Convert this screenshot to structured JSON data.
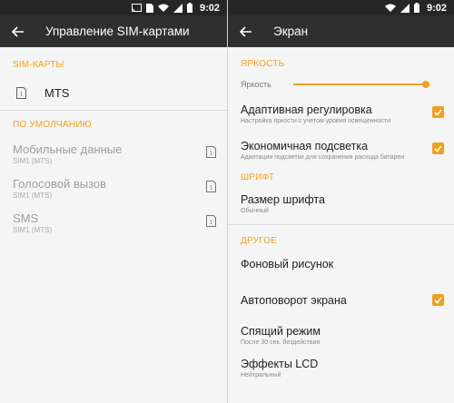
{
  "status": {
    "time": "9:02",
    "icons": [
      "cast-icon",
      "sim-icon",
      "wifi-icon",
      "signal-icon",
      "battery-icon"
    ]
  },
  "left": {
    "title": "Управление SIM-картами",
    "section_sim": "SIM-КАРТЫ",
    "sim_name": "MTS",
    "sim_icon_text": "1",
    "section_default": "ПО УМОЛЧАНИЮ",
    "defaults": [
      {
        "title": "Мобильные данные",
        "sub": "SIM1 (MTS)"
      },
      {
        "title": "Голосовой вызов",
        "sub": "SIM1 (MTS)"
      },
      {
        "title": "SMS",
        "sub": "SIM1 (MTS)"
      }
    ]
  },
  "right": {
    "title": "Экран",
    "section_brightness": "ЯРКОСТЬ",
    "brightness_label": "Яркость",
    "brightness_level": 1.0,
    "adaptive": {
      "title": "Адаптивная регулировка",
      "sub": "Настройка яркости с учетом уровня освещенности",
      "checked": true
    },
    "economy": {
      "title": "Экономичная подсветка",
      "sub": "Адаптация подсветки для сохранения расхода батареи",
      "checked": true
    },
    "section_font": "ШРИФТ",
    "font_size": {
      "title": "Размер шрифта",
      "sub": "Обычный"
    },
    "section_other": "ДРУГОЕ",
    "wallpaper": {
      "title": "Фоновый рисунок"
    },
    "autorotate": {
      "title": "Автоповорот экрана",
      "checked": true
    },
    "sleep": {
      "title": "Спящий режим",
      "sub": "После 30 сек. бездействия"
    },
    "lcd": {
      "title": "Эффекты LCD",
      "sub": "Нейтральный"
    }
  },
  "colors": {
    "accent": "#f0a020",
    "toolbar": "#2f2f2f",
    "statusbar": "#262626",
    "background": "#f5f5f5"
  }
}
